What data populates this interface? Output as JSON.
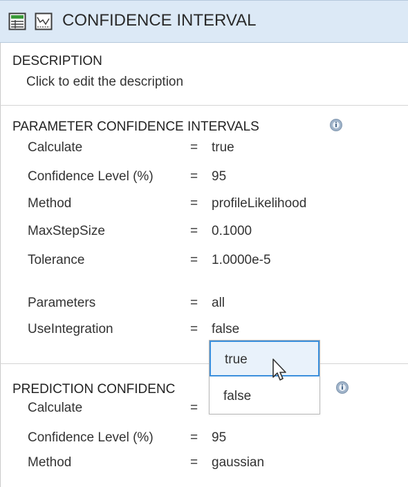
{
  "header": {
    "title": "CONFIDENCE INTERVAL",
    "icons": [
      "table-view-icon",
      "plot-view-icon"
    ]
  },
  "description": {
    "title": "DESCRIPTION",
    "text": "Click to edit the description"
  },
  "parameter_section": {
    "title": "PARAMETER CONFIDENCE INTERVALS",
    "info_icon": "info-icon",
    "rows": [
      {
        "name": "Calculate",
        "value": "true"
      },
      {
        "name": "Confidence Level (%)",
        "value": "95"
      },
      {
        "name": "Method",
        "value": "profileLikelihood"
      },
      {
        "name": "MaxStepSize",
        "value": "0.1000"
      },
      {
        "name": "Tolerance",
        "value": "1.0000e-5"
      },
      {
        "name": "Parameters",
        "value": "all"
      },
      {
        "name": "UseIntegration",
        "value": "false"
      }
    ],
    "equals": "="
  },
  "prediction_section": {
    "title": "PREDICTION CONFIDENC",
    "info_icon": "info-icon",
    "rows": [
      {
        "name": "Calculate",
        "value": ""
      },
      {
        "name": "Confidence Level (%)",
        "value": "95"
      },
      {
        "name": "Method",
        "value": "gaussian"
      }
    ],
    "equals": "="
  },
  "dropdown": {
    "options": [
      "true",
      "false"
    ],
    "highlighted": "true"
  },
  "colors": {
    "header_bg": "#dce9f6",
    "selection_border": "#3b8fdc",
    "info_icon": "#8fa6c0"
  }
}
